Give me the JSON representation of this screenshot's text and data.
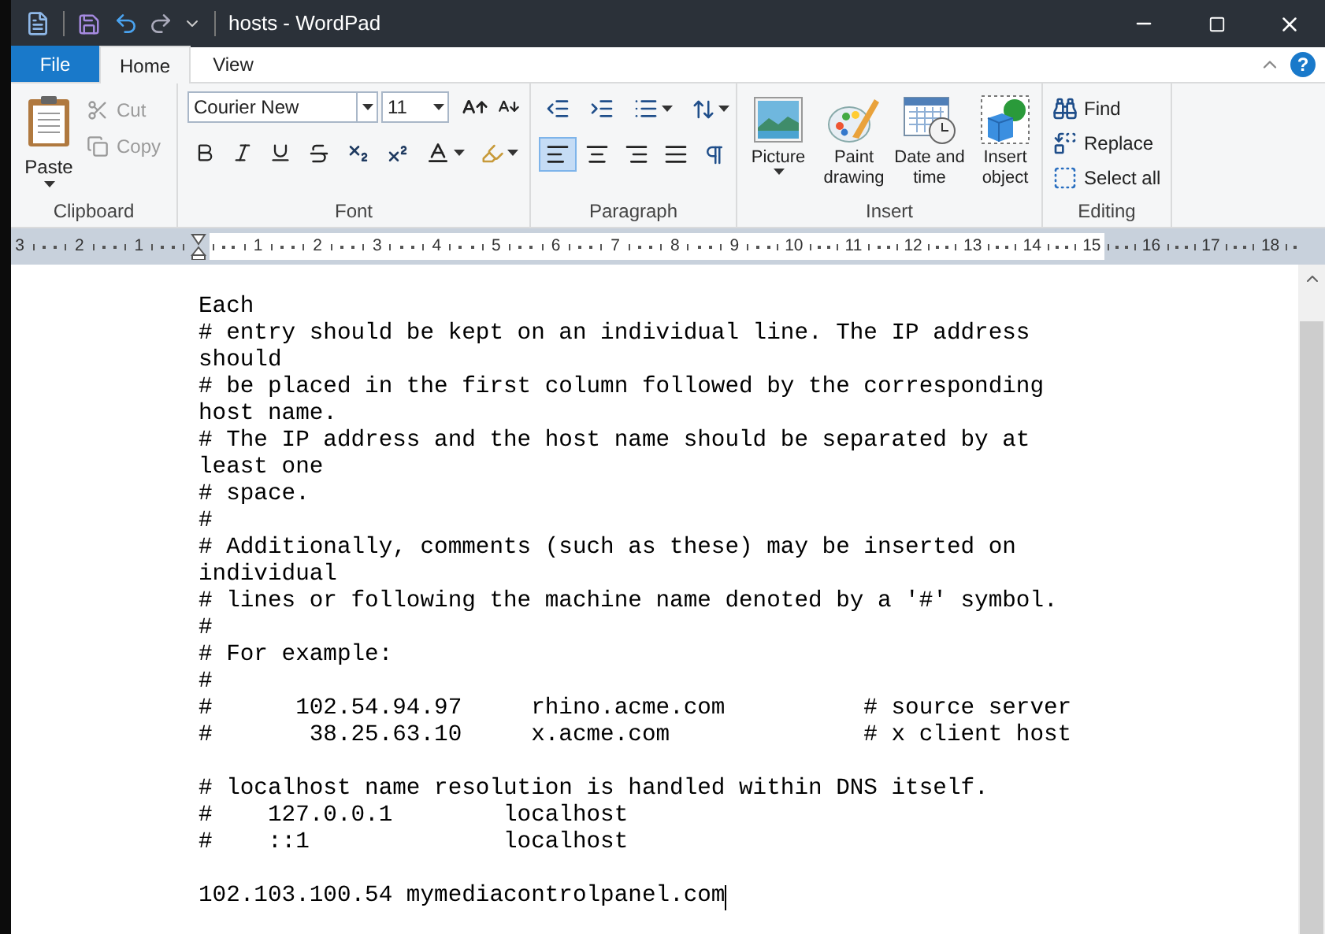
{
  "window": {
    "title": "hosts - WordPad"
  },
  "file_menu": "File",
  "ribbon_tabs": [
    {
      "label": "Home",
      "selected": true
    },
    {
      "label": "View",
      "selected": false
    }
  ],
  "help": "?",
  "clipboard": {
    "label": "Clipboard",
    "paste": "Paste",
    "cut": {
      "label": "Cut",
      "disabled": true
    },
    "copy": {
      "label": "Copy",
      "disabled": true
    }
  },
  "font": {
    "label": "Font",
    "family": "Courier New",
    "size": "11"
  },
  "paragraph": {
    "label": "Paragraph",
    "alignments": [
      {
        "kind": "left",
        "selected": true
      },
      {
        "kind": "center",
        "selected": false
      },
      {
        "kind": "right",
        "selected": false
      },
      {
        "kind": "justify",
        "selected": false
      }
    ]
  },
  "insert": {
    "label": "Insert",
    "buttons": [
      {
        "kind": "picture",
        "label": "Picture"
      },
      {
        "kind": "paint",
        "label": "Paint drawing"
      },
      {
        "kind": "datetime",
        "label": "Date and time"
      },
      {
        "kind": "object",
        "label": "Insert object"
      }
    ]
  },
  "editing": {
    "label": "Editing",
    "buttons": [
      {
        "kind": "find",
        "label": "Find"
      },
      {
        "kind": "replace",
        "label": "Replace"
      },
      {
        "kind": "selectall",
        "label": "Select all"
      }
    ]
  },
  "ruler": {
    "marks": [
      {
        "kind": "number",
        "label": "3"
      },
      {
        "kind": "number",
        "label": "2"
      },
      {
        "kind": "number",
        "label": "1"
      },
      {
        "kind": "indent_marker"
      },
      {
        "kind": "number",
        "label": "1"
      },
      {
        "kind": "number",
        "label": "2"
      },
      {
        "kind": "number",
        "label": "3"
      },
      {
        "kind": "number",
        "label": "4"
      },
      {
        "kind": "number",
        "label": "5"
      },
      {
        "kind": "number",
        "label": "6"
      },
      {
        "kind": "number",
        "label": "7"
      },
      {
        "kind": "number",
        "label": "8"
      },
      {
        "kind": "number",
        "label": "9"
      },
      {
        "kind": "number",
        "label": "10"
      },
      {
        "kind": "number",
        "label": "11"
      },
      {
        "kind": "number",
        "label": "12"
      },
      {
        "kind": "number",
        "label": "13"
      },
      {
        "kind": "number",
        "label": "14"
      },
      {
        "kind": "number",
        "label": "15"
      },
      {
        "kind": "number",
        "label": "16"
      },
      {
        "kind": "number",
        "label": "17"
      },
      {
        "kind": "number",
        "label": "18"
      }
    ]
  },
  "document": {
    "blocks": [
      {
        "lines": [
          {
            "text": "Each"
          },
          {
            "text": "# entry should be kept on an individual line. The IP address"
          },
          {
            "text": "should"
          },
          {
            "text": "# be placed in the first column followed by the corresponding"
          },
          {
            "text": "host name."
          },
          {
            "text": "# The IP address and the host name should be separated by at"
          },
          {
            "text": "least one"
          },
          {
            "text": "# space."
          },
          {
            "text": "#"
          },
          {
            "text": "# Additionally, comments (such as these) may be inserted on"
          },
          {
            "text": "individual"
          },
          {
            "text": "# lines or following the machine name denoted by a '#' symbol."
          },
          {
            "text": "#"
          },
          {
            "text": "# For example:"
          },
          {
            "text": "#"
          },
          {
            "text": "#      102.54.94.97     rhino.acme.com          # source server"
          },
          {
            "text": "#       38.25.63.10     x.acme.com              # x client host"
          }
        ]
      },
      {
        "lines": [
          {
            "text": "# localhost name resolution is handled within DNS itself."
          },
          {
            "text": "#    127.0.0.1        localhost"
          },
          {
            "text": "#    ::1              localhost"
          }
        ]
      },
      {
        "lines": [
          {
            "text": "102.103.100.54 mymediacontrolpanel.com",
            "cursor": true
          }
        ]
      }
    ]
  }
}
